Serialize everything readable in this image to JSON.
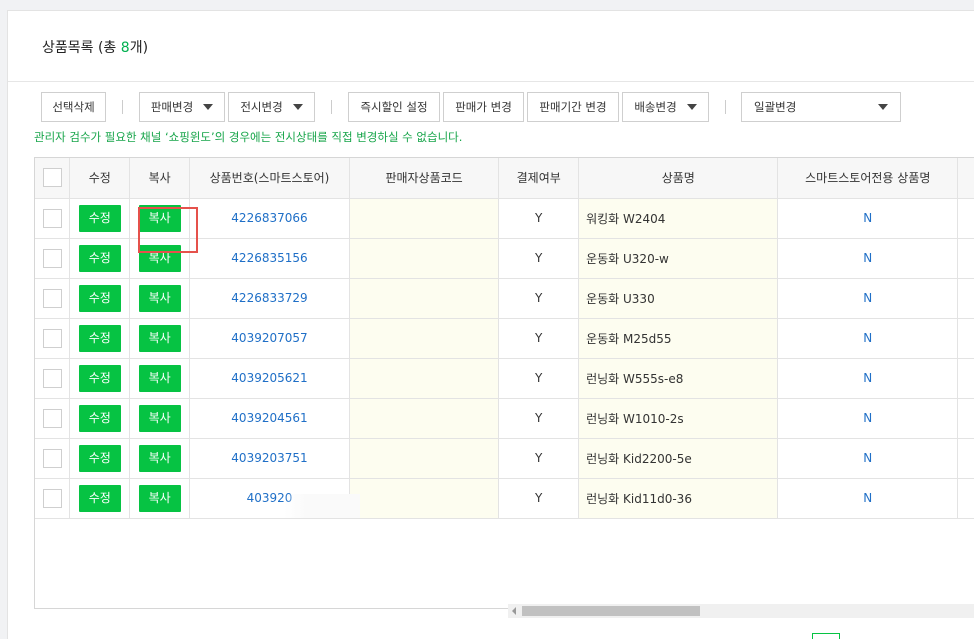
{
  "header": {
    "title_prefix": "상품목록 (총 ",
    "title_count": "8",
    "title_suffix": "개)"
  },
  "toolbar": {
    "delete_selected": "선택삭제",
    "sale_change": "판매변경",
    "display_change": "전시변경",
    "instant_discount": "즉시할인 설정",
    "price_change": "판매가 변경",
    "period_change": "판매기간 변경",
    "shipping_change": "배송변경",
    "bulk_change": "일괄변경"
  },
  "notice": "관리자 검수가 필요한 채널 ‘쇼핑윈도’의 경우에는 전시상태를 직접 변경하실 수 없습니다.",
  "table": {
    "headers": {
      "edit": "수정",
      "copy": "복사",
      "product_no": "상품번호(스마트스토어)",
      "seller_code": "판매자상품코드",
      "payment": "결제여부",
      "product_name": "상품명",
      "store_name": "스마트스토어전용 상품명"
    },
    "edit_label": "수정",
    "copy_label": "복사",
    "rows": [
      {
        "id": "4226837066",
        "seller_code": "",
        "paid": "Y",
        "name": "워킹화 W2404",
        "store_only": "N"
      },
      {
        "id": "4226835156",
        "seller_code": "",
        "paid": "Y",
        "name": "운동화 U320-w",
        "store_only": "N"
      },
      {
        "id": "4226833729",
        "seller_code": "",
        "paid": "Y",
        "name": "운동화 U330",
        "store_only": "N"
      },
      {
        "id": "4039207057",
        "seller_code": "",
        "paid": "Y",
        "name": "운동화 M25d55",
        "store_only": "N"
      },
      {
        "id": "4039205621",
        "seller_code": "",
        "paid": "Y",
        "name": "런닝화 W555s-e8",
        "store_only": "N"
      },
      {
        "id": "4039204561",
        "seller_code": "",
        "paid": "Y",
        "name": "런닝화 W1010-2s",
        "store_only": "N"
      },
      {
        "id": "4039203751",
        "seller_code": "",
        "paid": "Y",
        "name": "런닝화 Kid2200-5e",
        "store_only": "N"
      },
      {
        "id": "403920",
        "seller_code": "",
        "paid": "Y",
        "name": "런닝화 Kid11d0-36",
        "store_only": "N"
      }
    ]
  },
  "colors": {
    "accent_green": "#06c343",
    "link_blue": "#1f6fc7",
    "highlight_red": "#e5514b",
    "notice_green": "#17a54a"
  }
}
